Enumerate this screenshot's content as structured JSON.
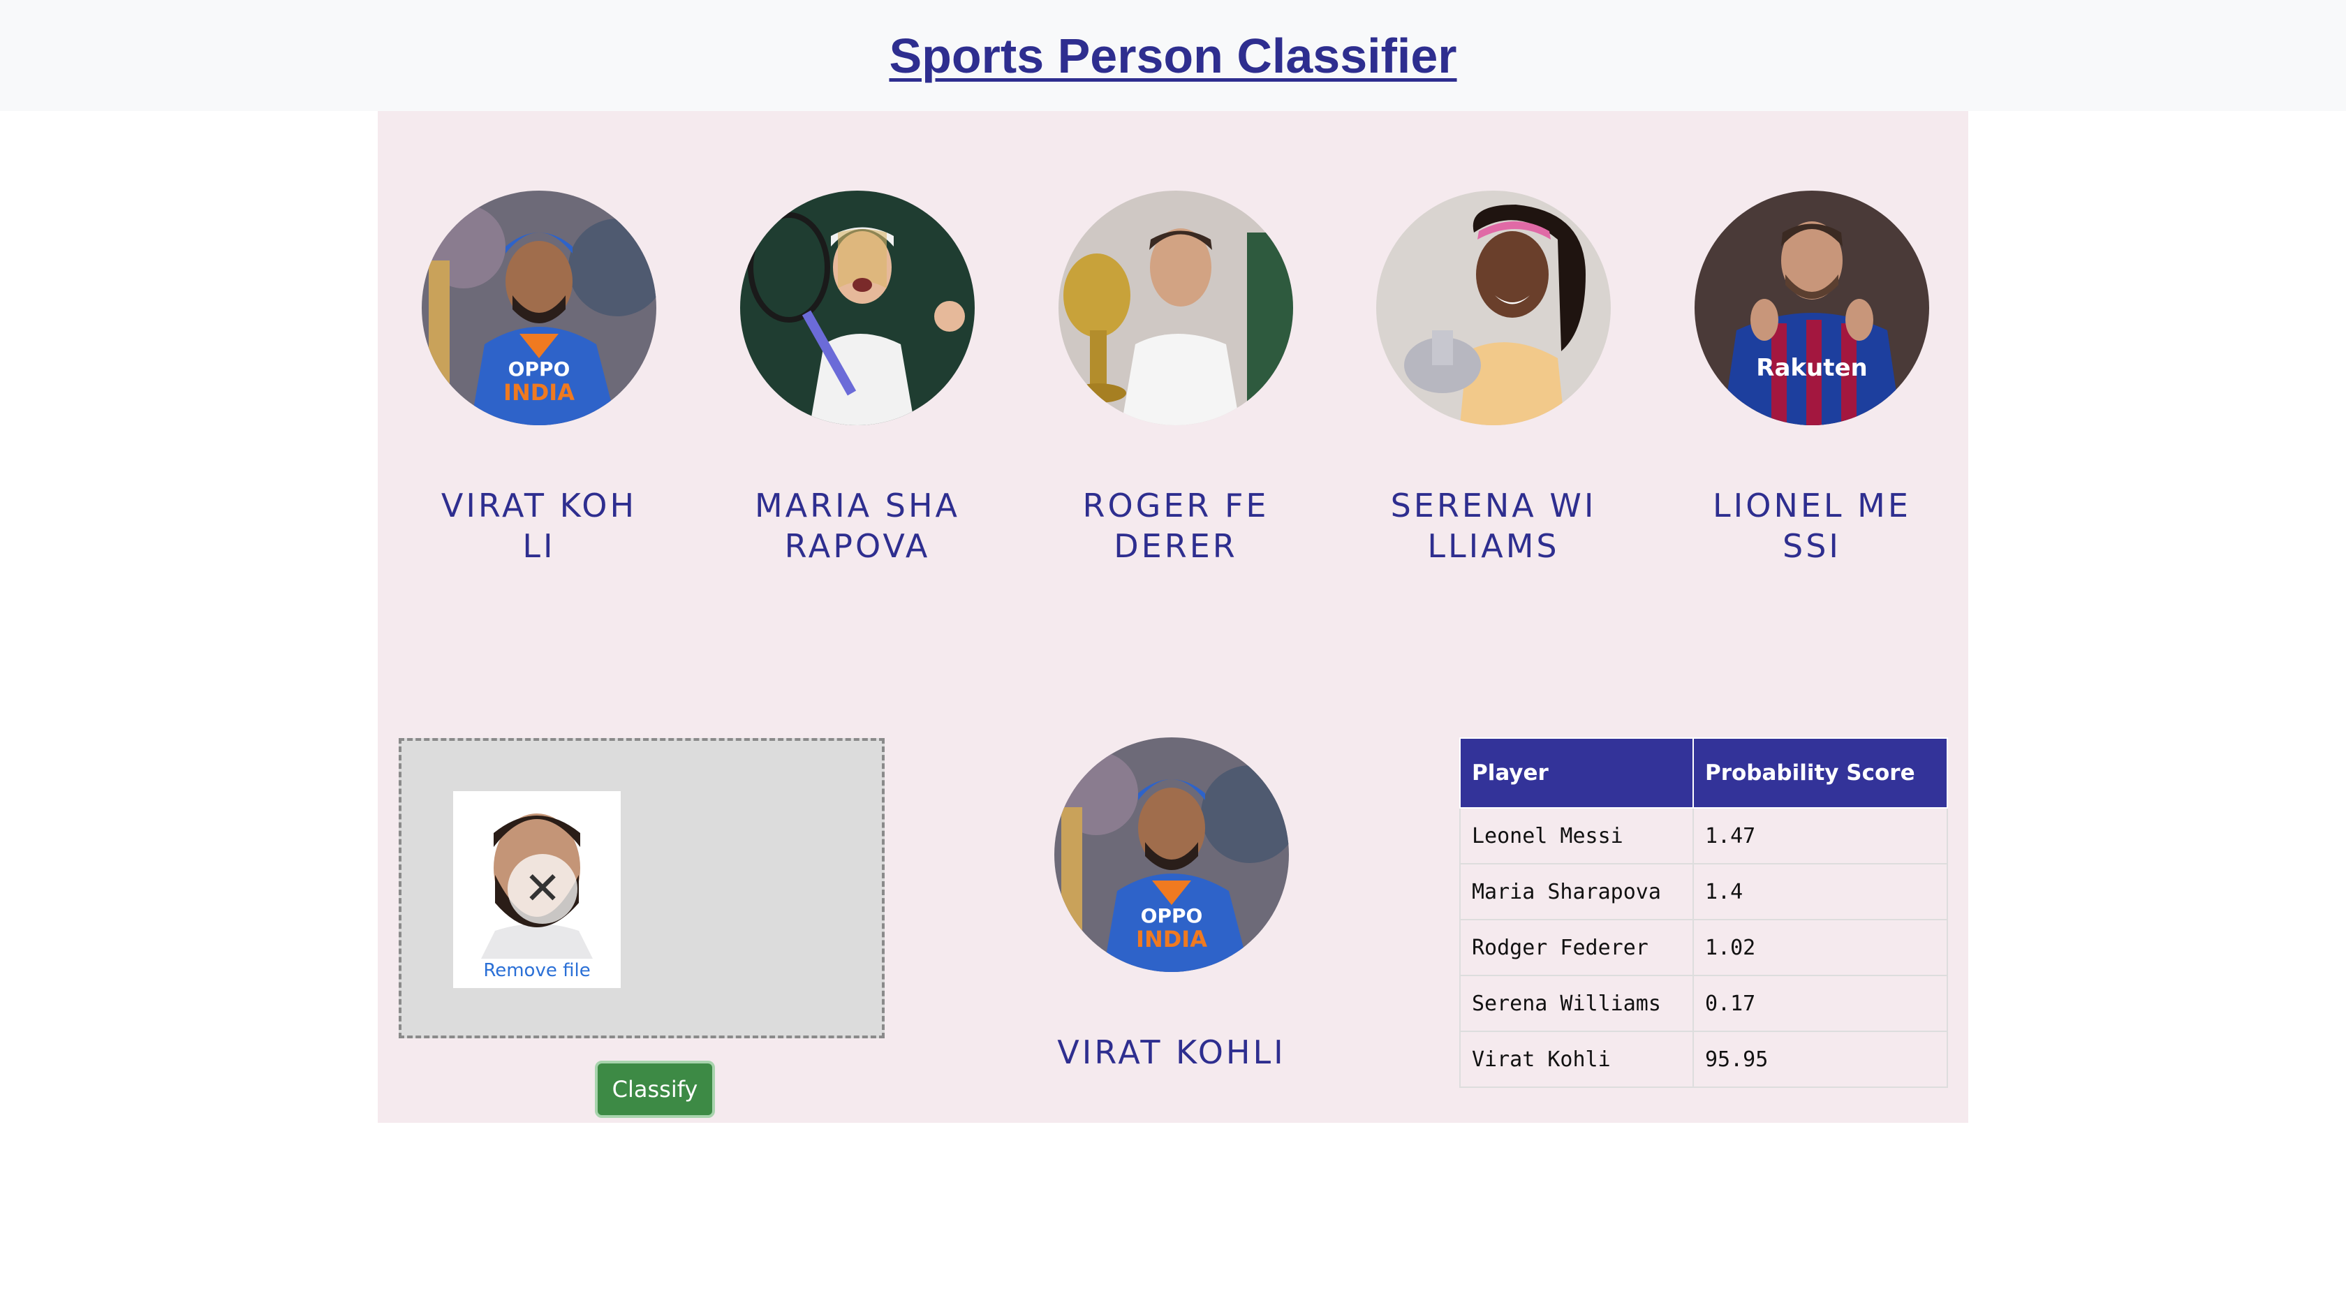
{
  "header": {
    "title": "Sports Person Classifier"
  },
  "players": [
    {
      "name": "Virat Kohli",
      "avatar": "virat-kohli-avatar"
    },
    {
      "name": "Maria Sharapova",
      "avatar": "maria-sharapova-avatar"
    },
    {
      "name": "Roger Federer",
      "avatar": "roger-federer-avatar"
    },
    {
      "name": "Serena Williams",
      "avatar": "serena-williams-avatar"
    },
    {
      "name": "Lionel Messi",
      "avatar": "lionel-messi-avatar"
    }
  ],
  "upload": {
    "remove_label": "Remove file",
    "classify_label": "Classify"
  },
  "result": {
    "name": "VIRAT KOHLI"
  },
  "table": {
    "headers": [
      "Player",
      "Probability Score"
    ],
    "rows": [
      [
        "Leonel Messi",
        "1.47"
      ],
      [
        "Maria Sharapova",
        "1.4"
      ],
      [
        "Rodger Federer",
        "1.02"
      ],
      [
        "Serena Williams",
        "0.17"
      ],
      [
        "Virat Kohli",
        "95.95"
      ]
    ]
  },
  "colors": {
    "accent": "#2e2e8f",
    "table_header": "#333399",
    "panel_bg": "#f5eaee",
    "button": "#3d8a45",
    "link": "#2a6fd6"
  }
}
